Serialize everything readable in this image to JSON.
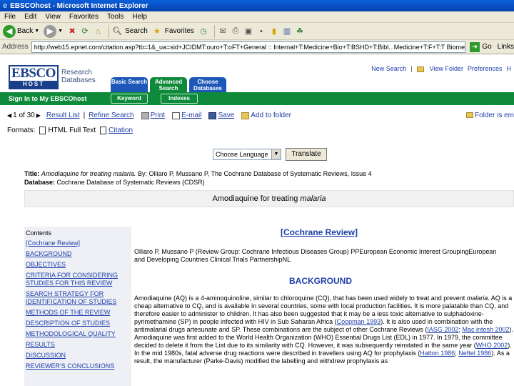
{
  "window": {
    "title": "EBSCOhost - Microsoft Internet Explorer"
  },
  "menu": [
    "File",
    "Edit",
    "View",
    "Favorites",
    "Tools",
    "Help"
  ],
  "toolbar": {
    "back": "Back",
    "search": "Search",
    "favorites": "Favorites"
  },
  "address": {
    "label": "Address",
    "url": "http://web15.epnet.com/citation.asp?tb=1&_ua=sid+JCIDMT:ouro+T:oFT+General :: Internal+T:Medicine+Bio+T:BSHD+T:Bibl...Medicine+T:F+T:T Biomedical+T Science",
    "go": "Go",
    "links": "Links"
  },
  "header": {
    "logo_main": "EBSCO",
    "logo_sub": "HOST",
    "tagline_1": "Research",
    "tagline_2": "Databases",
    "tabs": [
      {
        "label": "Basic Search"
      },
      {
        "label": "Advanced Search"
      },
      {
        "label": "Choose Databases"
      }
    ],
    "links": {
      "new_search": "New Search",
      "view_folder": "View Folder",
      "preferences": "Preferences",
      "more": "H"
    },
    "signin": "Sign In to My EBSCOhost",
    "subtabs": [
      "Keyword",
      "Indexes"
    ]
  },
  "result_nav": {
    "position": "1 of 30",
    "result_list": "Result List",
    "refine_search": "Refine Search",
    "print": "Print",
    "email": "E-mail",
    "save": "Save",
    "add_to_folder": "Add to folder",
    "folder_status": "Folder is em"
  },
  "formats": {
    "label": "Formats:",
    "html": "HTML Full Text",
    "citation": "Citation"
  },
  "language": {
    "select": "Choose Language",
    "translate": "Translate"
  },
  "meta": {
    "title_label": "Title:",
    "title_value": "Amodiaquine for treating malaria.",
    "by": "By: Olliaro P, Mussano P, The Cochrane Database of Systematic Reviews, Issue 4",
    "database_label": "Database:",
    "database_value": "Cochrane Database of Systematic Reviews (CDSR)"
  },
  "article_title": {
    "prefix": "Amodiaquine for treating ",
    "italic": "malaria"
  },
  "contents": {
    "heading": "Contents",
    "items": [
      "[Cochrane Review]",
      "BACKGROUND",
      "OBJECTIVES",
      "CRITERIA FOR CONSIDERING STUDIES FOR THIS REVIEW",
      "SEARCH STRATEGY FOR IDENTIFICATION OF STUDIES",
      "METHODS OF THE REVIEW",
      "DESCRIPTION OF STUDIES",
      "METHODOLOGICAL QUALITY",
      "RESULTS",
      "DISCUSSION",
      "REVIEWER'S CONCLUSIONS"
    ]
  },
  "review": {
    "link": "[Cochrane Review]",
    "authors": "Olliaro P, Mussano P (Review Group: Cochrane Infectious Diseases Group) PPEuropean Economic Interest GroupingEuropean and Developing Countries Clinical Trials PartnershipNL",
    "background_heading": "BACKGROUND",
    "para1_a": "Amodiaquine (AQ) is a 4-aminoquinoline, similar to chloroquine (CQ), that has been used widely to treat and prevent",
    "para1_italic": "malaria",
    "para1_b": ". AQ is a cheap alternative to CQ, and is available in several countries, some with local production facilities. It is more palatable than CQ, and therefore easier to administer to children. It has also been suggested that it may be a less toxic alternative to sulphadoxine-pyrimethamine (SP) in people infected with HIV in Sub Saharan Africa (",
    "para1_ref1": "Coopman 1993",
    "para1_c": "). It is also used in combination with the antimalarial drugs artesunate and SP. These combinations are the subject of other Cochrane Reviews (",
    "para1_ref2": "IASG 2002",
    "para1_sep": "; ",
    "para1_ref3": "Mac intosh 2002",
    "para1_d": ").",
    "para2_a": "Amodiaquine was first added to the World Health Organization (WHO) Essential Drugs List (EDL) in 1977. In 1979, the committee decided to delete it from the List due to its similarity with CQ. However, it was subsequently reinstated in the same year (",
    "para2_ref1": "WHO 2002",
    "para2_b": "). In the mid 1980s, fatal adverse drug reactions were described in travellers using AQ for prophylaxis (",
    "para2_ref2": "Hatton 1986",
    "para2_sep": "; ",
    "para2_ref3": "Neftel 1986",
    "para2_c": "). As a result, the manufacturer (Parke-Davis) modified the labelling and withdrew prophylaxis as"
  }
}
